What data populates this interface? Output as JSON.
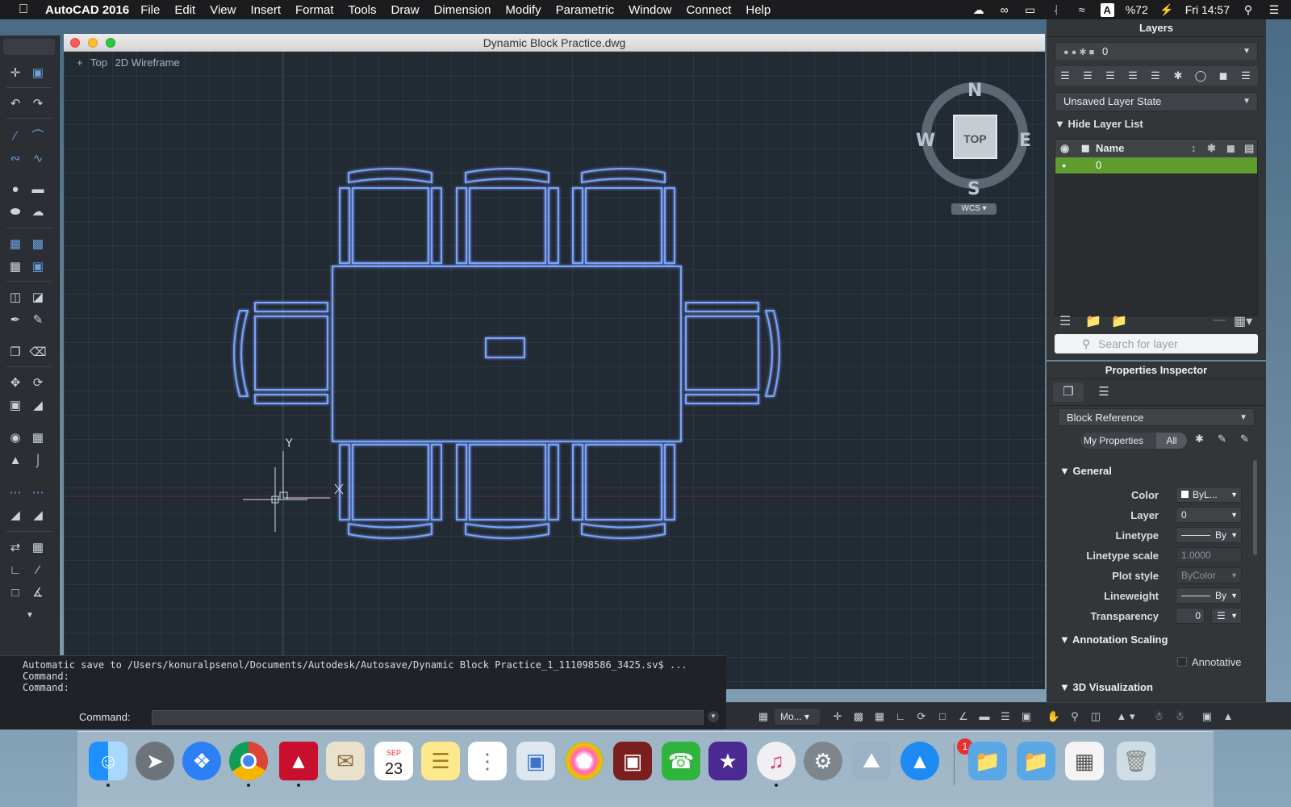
{
  "menubar": {
    "app_name": "AutoCAD 2016",
    "items": [
      "File",
      "Edit",
      "View",
      "Insert",
      "Format",
      "Tools",
      "Draw",
      "Dimension",
      "Modify",
      "Parametric",
      "Window",
      "Connect",
      "Help"
    ],
    "battery": "%72",
    "clock": "Fri 14:57",
    "input_source": "A"
  },
  "window": {
    "title": "Dynamic Block Practice.dwg",
    "view_labels": [
      "+",
      "Top",
      "2D Wireframe"
    ]
  },
  "viewcube": {
    "north": "N",
    "south": "S",
    "east": "E",
    "west": "W",
    "face": "TOP",
    "wcs": "WCS"
  },
  "ucs": {
    "y_label": "Y"
  },
  "command": {
    "history": [
      "Automatic save to /Users/konuralpsenol/Documents/Autodesk/Autosave/Dynamic Block Practice_1_111098586_3425.sv$ ...",
      "Command:",
      "Command:"
    ],
    "prompt": "Command:"
  },
  "statusbar": {
    "model_label": "Mo..."
  },
  "layers": {
    "title": "Layers",
    "current_layer": "0",
    "layer_state": "Unsaved Layer State",
    "hide_list": "Hide Layer List",
    "column_name": "Name",
    "rows": [
      {
        "name": "0"
      }
    ],
    "search_placeholder": "Search for layer"
  },
  "properties": {
    "title": "Properties Inspector",
    "object_type": "Block Reference",
    "filter_my": "My Properties",
    "filter_all": "All",
    "sections": {
      "general": "General",
      "annotation": "Annotation Scaling",
      "viz": "3D Visualization"
    },
    "general": [
      {
        "label": "Color",
        "value": "ByL..."
      },
      {
        "label": "Layer",
        "value": "0"
      },
      {
        "label": "Linetype",
        "value": "By"
      },
      {
        "label": "Linetype scale",
        "value": "1.0000"
      },
      {
        "label": "Plot style",
        "value": "ByColor"
      },
      {
        "label": "Lineweight",
        "value": "By"
      },
      {
        "label": "Transparency",
        "value": "0"
      }
    ],
    "annotative_label": "Annotative"
  },
  "dock": {
    "calendar_month": "SEP",
    "calendar_day": "23",
    "appstore_badge": "1"
  },
  "colors": {
    "canvas": "#222a33",
    "linework": "#7aa2ff",
    "layer_highlight": "#5e9c2e"
  }
}
